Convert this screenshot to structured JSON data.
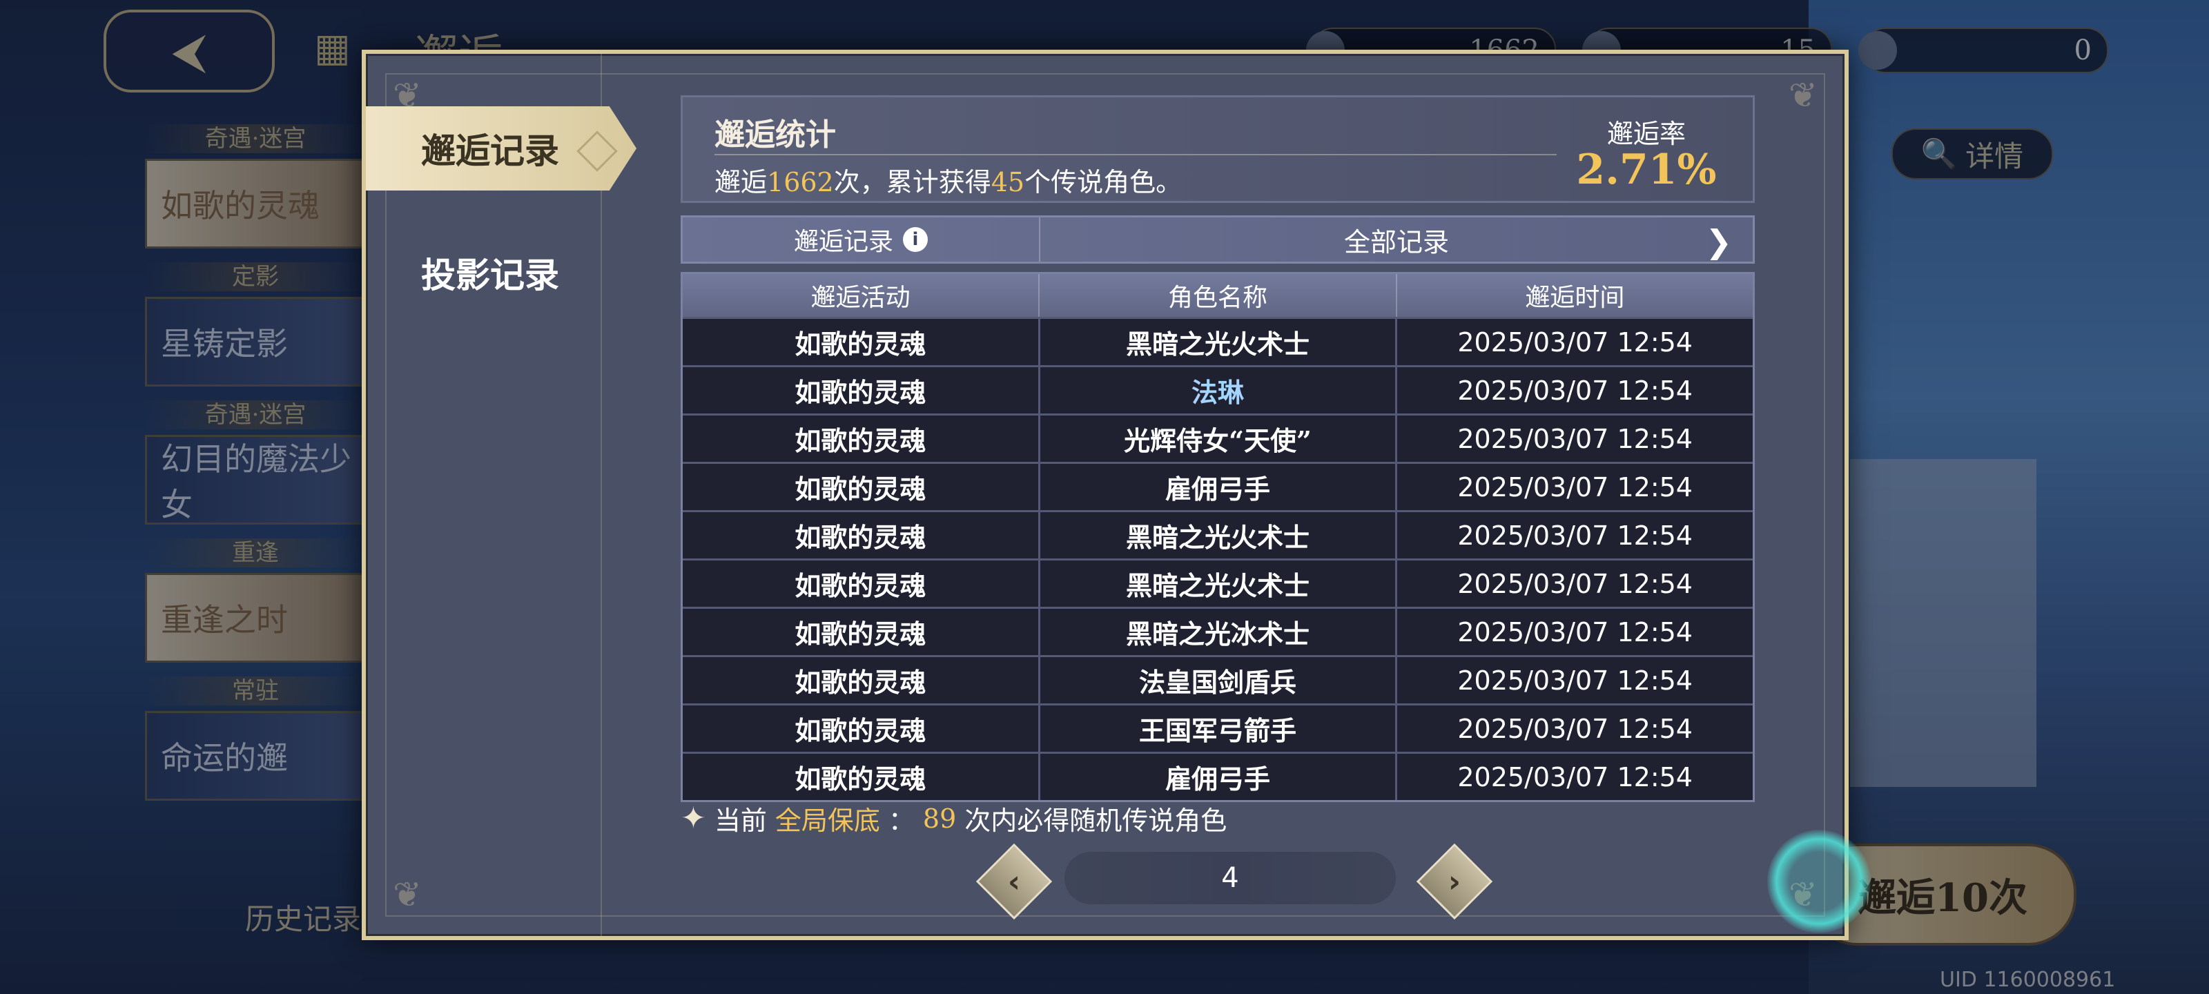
{
  "background": {
    "top_title": "邂逅",
    "currencies": [
      "1662",
      "15",
      "0"
    ],
    "side_groups": [
      {
        "caption": "奇遇·迷宫",
        "card": "如歌的灵魂"
      },
      {
        "caption": "定影",
        "card": "星铸定影"
      },
      {
        "caption": "奇遇·迷宫",
        "card": "幻目的魔法少女"
      },
      {
        "caption": "重逢",
        "card": "重逢之时"
      },
      {
        "caption": "常驻",
        "card": "命运的邂"
      }
    ],
    "history_link": "历史记录",
    "detail_button": "详情",
    "draw10_button": "邂逅10次",
    "uid": "UID 1160008961"
  },
  "tabs": [
    {
      "label": "邂逅记录",
      "active": true
    },
    {
      "label": "投影记录",
      "active": false
    }
  ],
  "stats": {
    "title": "邂逅统计",
    "prefix": "邂逅",
    "count": "1662",
    "middle": "次，累计获得",
    "legendary": "45",
    "suffix": "个传说角色。",
    "rate_label": "邂逅率",
    "rate_value": "2.71%"
  },
  "filter": {
    "left_label": "邂逅记录",
    "right_label": "全部记录"
  },
  "table": {
    "headers": [
      "邂逅活动",
      "角色名称",
      "邂逅时间"
    ],
    "rows": [
      {
        "event": "如歌的灵魂",
        "name": "黑暗之光火术士",
        "time": "2025/03/07 12:54"
      },
      {
        "event": "如歌的灵魂",
        "name": "法琳",
        "time": "2025/03/07 12:54",
        "highlight": true
      },
      {
        "event": "如歌的灵魂",
        "name": "光辉侍女“天使”",
        "time": "2025/03/07 12:54"
      },
      {
        "event": "如歌的灵魂",
        "name": "雇佣弓手",
        "time": "2025/03/07 12:54"
      },
      {
        "event": "如歌的灵魂",
        "name": "黑暗之光火术士",
        "time": "2025/03/07 12:54"
      },
      {
        "event": "如歌的灵魂",
        "name": "黑暗之光火术士",
        "time": "2025/03/07 12:54"
      },
      {
        "event": "如歌的灵魂",
        "name": "黑暗之光冰术士",
        "time": "2025/03/07 12:54"
      },
      {
        "event": "如歌的灵魂",
        "name": "法皇国剑盾兵",
        "time": "2025/03/07 12:54"
      },
      {
        "event": "如歌的灵魂",
        "name": "王国军弓箭手",
        "time": "2025/03/07 12:54"
      },
      {
        "event": "如歌的灵魂",
        "name": "雇佣弓手",
        "time": "2025/03/07 12:54"
      }
    ]
  },
  "pity": {
    "prefix": "当前",
    "label": "全局保底",
    "colon": "：",
    "count": "89",
    "suffix": "次内必得随机传说角色"
  },
  "pager": {
    "page": "4"
  },
  "icons": {
    "back": "back-arrow-icon",
    "info": "info-icon",
    "next": "chevron-right-icon",
    "prev": "chevron-left-icon",
    "star": "sparkle-icon"
  },
  "colors": {
    "accent_gold": "#f2c45a",
    "modal_border": "#d8c99a",
    "tab_active": "#efe4c6"
  }
}
